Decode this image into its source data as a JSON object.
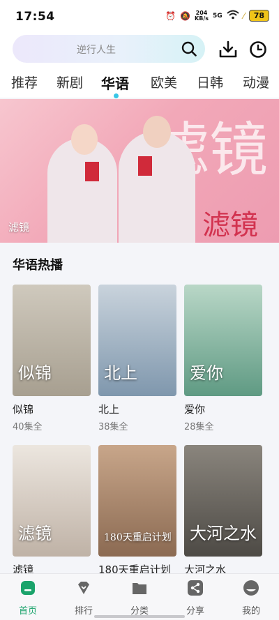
{
  "status": {
    "time": "17:54",
    "net_speed": "204",
    "net_unit": "KB/s",
    "signal": "5G",
    "battery": "78"
  },
  "search": {
    "placeholder": "逆行人生"
  },
  "tabs": [
    "推荐",
    "新剧",
    "华语",
    "欧美",
    "日韩",
    "动漫"
  ],
  "active_tab": "华语",
  "banner": {
    "caption": "滤镜",
    "art_text": "滤镜"
  },
  "section": {
    "title": "华语热播"
  },
  "shows": [
    {
      "name": "似锦",
      "episodes": "40集全",
      "art": "似锦",
      "color": "#bfb8ab"
    },
    {
      "name": "北上",
      "episodes": "38集全",
      "art": "北上",
      "color": "#9bb0c4"
    },
    {
      "name": "爱你",
      "episodes": "28集全",
      "art": "爱你",
      "color": "#86b4a0"
    },
    {
      "name": "滤镜",
      "episodes": "",
      "art": "滤镜",
      "color": "#d8cfc8"
    },
    {
      "name": "180天重启计划",
      "episodes": "",
      "art": "180天重启计划",
      "color": "#b99476"
    },
    {
      "name": "大河之水",
      "episodes": "",
      "art": "大河之水",
      "color": "#6e6a64"
    }
  ],
  "nav": [
    {
      "label": "首页",
      "icon": "home-icon",
      "active": true
    },
    {
      "label": "排行",
      "icon": "ranking-icon",
      "active": false
    },
    {
      "label": "分类",
      "icon": "folder-icon",
      "active": false
    },
    {
      "label": "分享",
      "icon": "share-icon",
      "active": false
    },
    {
      "label": "我的",
      "icon": "profile-icon",
      "active": false
    }
  ],
  "colors": {
    "accent": "#1aa36b",
    "tab_indicator": "#38c6e6"
  }
}
